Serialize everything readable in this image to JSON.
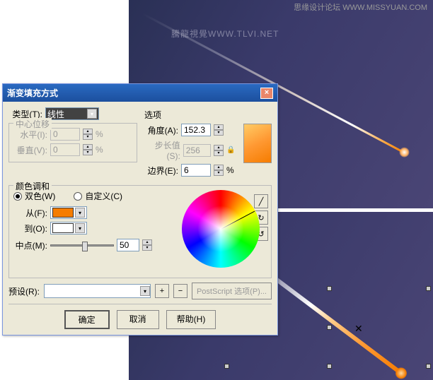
{
  "watermarks": {
    "top_right": "思缘设计论坛  WWW.MISSYUAN.COM",
    "brand_cn": "騰龍視覺",
    "brand_en": "WWW.TLVI.NET"
  },
  "dialog": {
    "title": "渐变填充方式",
    "close": "×",
    "type": {
      "label": "类型(T):",
      "value": "线性"
    },
    "center_offset": {
      "legend": "中心位移",
      "horizontal_label": "水平(I):",
      "horizontal_value": "0",
      "vertical_label": "垂直(V):",
      "vertical_value": "0",
      "percent": "%"
    },
    "options": {
      "legend": "选项",
      "angle_label": "角度(A):",
      "angle_value": "152.3",
      "step_label": "步长值(S):",
      "step_value": "256",
      "edge_label": "边界(E):",
      "edge_value": "6",
      "percent": "%",
      "lock_icon": "🔒"
    },
    "color_blend": {
      "legend": "颜色调和",
      "two_color_label": "双色(W)",
      "custom_label": "自定义(C)",
      "from_label": "从(F):",
      "from_color": "#f57c00",
      "to_label": "到(O):",
      "to_color": "#ffffff",
      "midpoint_label": "中点(M):",
      "midpoint_value": "50"
    },
    "preset": {
      "label": "预设(R):",
      "add_icon": "+",
      "remove_icon": "−",
      "postscript_btn": "PostScript 选项(P)..."
    },
    "buttons": {
      "ok": "确定",
      "cancel": "取消",
      "help": "帮助(H)"
    }
  }
}
